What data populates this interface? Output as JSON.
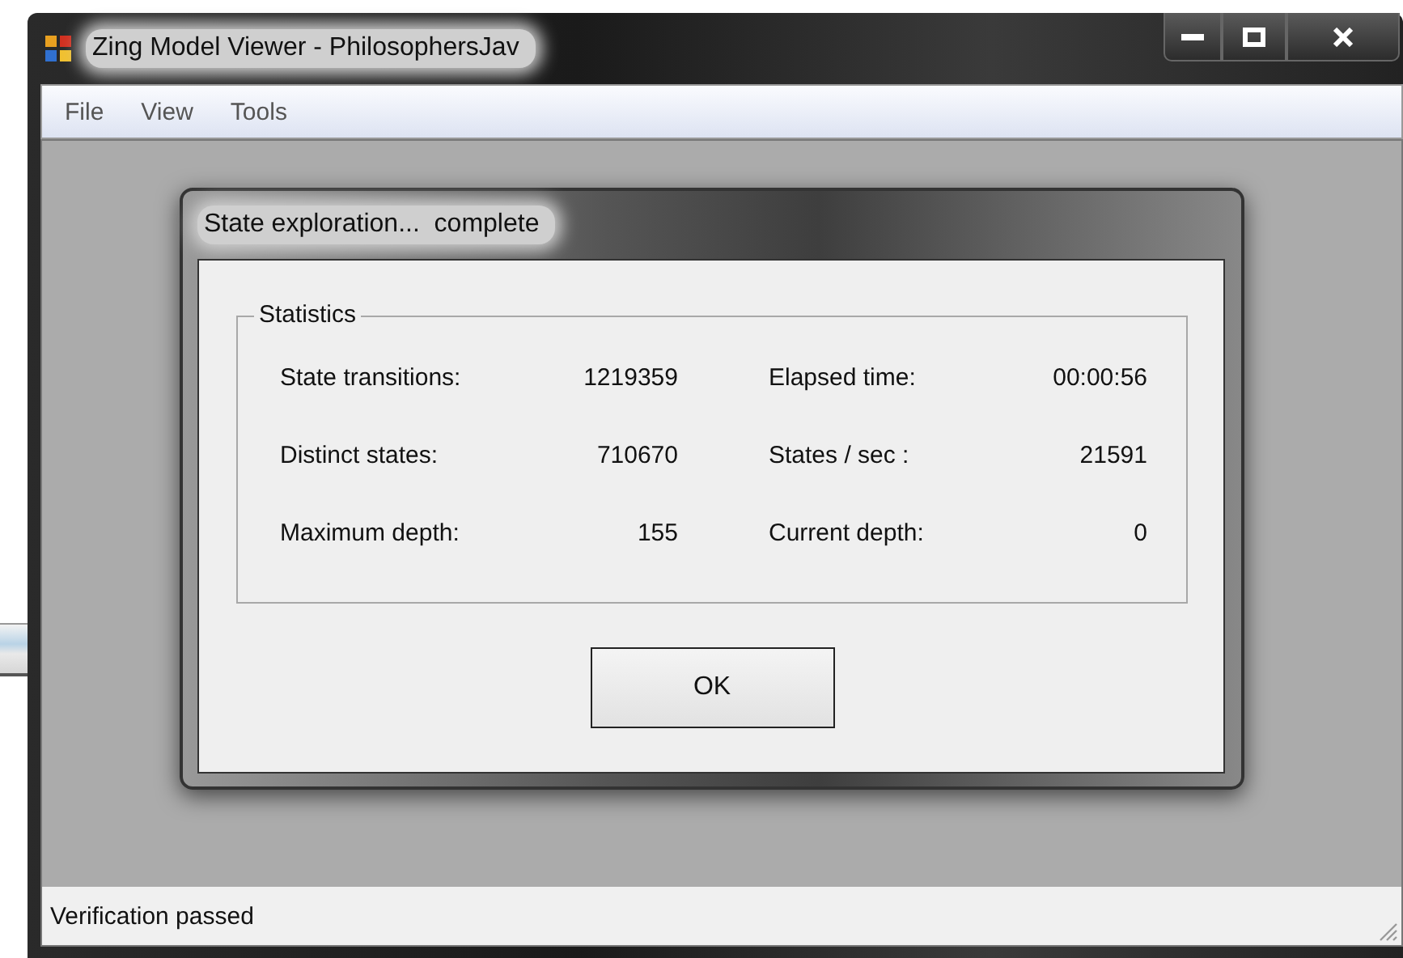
{
  "window": {
    "title": "Zing Model Viewer - PhilosophersJav"
  },
  "menu": [
    "File",
    "View",
    "Tools"
  ],
  "dialog": {
    "title": "State exploration...  complete",
    "group_title": "Statistics",
    "stats": [
      {
        "label": "State transitions:",
        "value": "1219359"
      },
      {
        "label": "Elapsed time:",
        "value": "00:00:56"
      },
      {
        "label": "Distinct states:",
        "value": "710670"
      },
      {
        "label": "States / sec :",
        "value": "21591"
      },
      {
        "label": "Maximum depth:",
        "value": "155"
      },
      {
        "label": "Current depth:",
        "value": "0"
      }
    ],
    "button": "OK"
  },
  "status_bar": "Verification passed"
}
